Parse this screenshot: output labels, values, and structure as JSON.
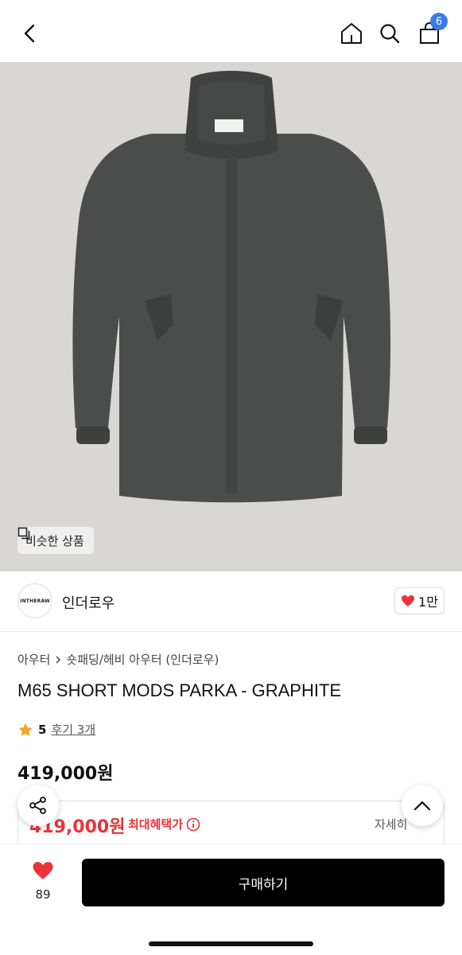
{
  "header": {
    "cart_count": "6",
    "icons": [
      "back-arrow-icon",
      "home-icon",
      "search-icon",
      "shopping-bag-icon"
    ]
  },
  "hero": {
    "similar_label": "비슷한 상품",
    "jacket_color": "#4a4d4b",
    "background_color": "#d9d7d3"
  },
  "brand": {
    "logo_text": "INTHERAW",
    "name": "인더로우",
    "likes": "1만"
  },
  "product": {
    "breadcrumb": [
      "아우터",
      "숏패딩/헤비 아우터 (인더로우)"
    ],
    "title": "M65 SHORT MODS PARKA - GRAPHITE",
    "rating": "5",
    "reviews": "후기 3개",
    "price": "419,000원"
  },
  "benefit": {
    "price": "419,000원",
    "label": "최대혜택가",
    "detail": "자세히"
  },
  "bottom": {
    "wish_count": "89",
    "buy_label": "구매하기"
  },
  "colors": {
    "accent_red": "#e8343a",
    "badge_blue": "#3a7bf0",
    "buy_button": "#000000"
  }
}
